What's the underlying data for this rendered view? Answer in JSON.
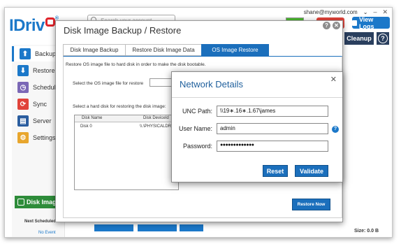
{
  "top_bar": {
    "account": "shane@myworld.com",
    "account_chevron": "⌄",
    "minimize": "–",
    "close": "✕"
  },
  "logo": {
    "text_i": "I",
    "text_drive": "Driv",
    "reg": "®"
  },
  "search": {
    "placeholder": "Search your account"
  },
  "header_buttons": {
    "view_logs": "View Logs",
    "cleanup": "Cleanup",
    "help": "?"
  },
  "sidebar": {
    "items": [
      {
        "label": "Backup",
        "icon": "backup-icon",
        "glyph": "⬆",
        "color": "#1b78c9"
      },
      {
        "label": "Restore",
        "icon": "restore-icon",
        "glyph": "⬇",
        "color": "#1b78c9"
      },
      {
        "label": "Schedule",
        "icon": "schedule-icon",
        "glyph": "◷",
        "color": "#7b68b6"
      },
      {
        "label": "Sync",
        "icon": "sync-icon",
        "glyph": "⟳",
        "color": "#e0433a"
      },
      {
        "label": "Server",
        "icon": "server-icon",
        "glyph": "▤",
        "color": "#2a5d9f"
      },
      {
        "label": "Settings",
        "icon": "settings-icon",
        "glyph": "⚙",
        "color": "#e8a62d"
      }
    ],
    "disk_image_button": "Disk Image",
    "next_scheduled": "Next Scheduled B",
    "no_event": "No Event"
  },
  "status": {
    "size": "Size: 0.0 B"
  },
  "disk_dialog": {
    "title": "Disk Image Backup / Restore",
    "tabs": [
      "Disk Image Backup",
      "Restore Disk Image Data",
      "OS Image Restore"
    ],
    "active_tab": "OS Image Restore",
    "description": "Restore OS image file to hard disk in order to make the disk bootable.",
    "select_file_label": "Select the OS image file for restore",
    "select_disk_label": "Select a hard disk for restoring the disk image:",
    "table": {
      "columns": [
        "Disk Name",
        "Disk DeviceId"
      ],
      "rows": [
        {
          "disk_name": "Disk 0",
          "device_id": "\\\\.\\PHYSICALDRIV"
        }
      ]
    },
    "restore_now": "Restore Now",
    "help_btn": "?",
    "close_btn": "✕"
  },
  "network_dialog": {
    "title": "Network Details",
    "close": "✕",
    "unc_label": "UNC Path:",
    "unc_value": "\\\\19∗.16∗.1.67\\james",
    "user_label": "User Name:",
    "user_value": "admin",
    "password_label": "Password:",
    "password_value": "●●●●●●●●●●●●●",
    "help": "?",
    "reset": "Reset",
    "validate": "Validate"
  },
  "colors": {
    "accent": "#1b6fbc",
    "brand_blue": "#1b78c9",
    "brand_red": "#e0242b",
    "green": "#2e8c3a"
  }
}
